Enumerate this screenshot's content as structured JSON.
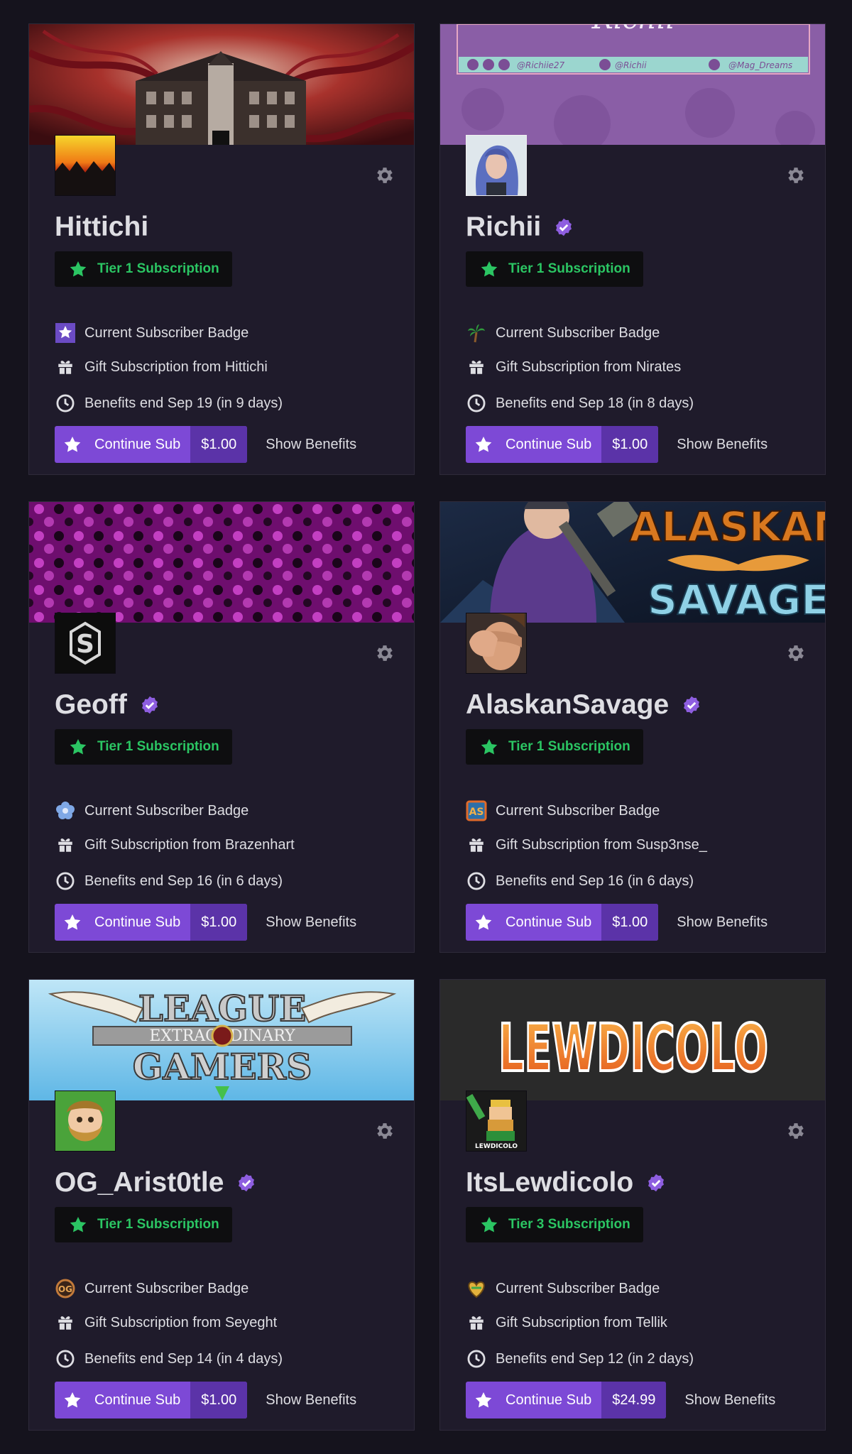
{
  "cards": [
    {
      "name": "Hittichi",
      "verified": false,
      "tier": "Tier 1 Subscription",
      "badge_label": "Current Subscriber Badge",
      "gift_label": "Gift Subscription from Hittichi",
      "benefits_end": "Benefits end Sep 19 (in 9 days)",
      "continue_label": "Continue Sub",
      "price": "$1.00",
      "show_benefits_label": "Show Benefits"
    },
    {
      "name": "Richii",
      "verified": true,
      "tier": "Tier 1 Subscription",
      "badge_label": "Current Subscriber Badge",
      "gift_label": "Gift Subscription from Nirates",
      "benefits_end": "Benefits end Sep 18 (in 8 days)",
      "continue_label": "Continue Sub",
      "price": "$1.00",
      "show_benefits_label": "Show Benefits",
      "banner_text": {
        "handle1": "@Richiie27",
        "handle2": "@Richii",
        "handle3": "@Mag_Dreams"
      }
    },
    {
      "name": "Geoff",
      "verified": true,
      "tier": "Tier 1 Subscription",
      "badge_label": "Current Subscriber Badge",
      "gift_label": "Gift Subscription from Brazenhart",
      "benefits_end": "Benefits end Sep 16 (in 6 days)",
      "continue_label": "Continue Sub",
      "price": "$1.00",
      "show_benefits_label": "Show Benefits"
    },
    {
      "name": "AlaskanSavage",
      "verified": true,
      "tier": "Tier 1 Subscription",
      "badge_label": "Current Subscriber Badge",
      "gift_label": "Gift Subscription from Susp3nse_",
      "benefits_end": "Benefits end Sep 16 (in 6 days)",
      "continue_label": "Continue Sub",
      "price": "$1.00",
      "show_benefits_label": "Show Benefits",
      "banner_text": {
        "line1": "ALASKAN",
        "line2": "SAVAGE"
      }
    },
    {
      "name": "OG_Arist0tle",
      "verified": true,
      "tier": "Tier 1 Subscription",
      "badge_label": "Current Subscriber Badge",
      "gift_label": "Gift Subscription from Seyeght",
      "benefits_end": "Benefits end Sep 14 (in 4 days)",
      "continue_label": "Continue Sub",
      "price": "$1.00",
      "show_benefits_label": "Show Benefits",
      "banner_text": {
        "line1": "LEAGUE",
        "line2": "EXTRAORDINARY",
        "line3": "GAMERS"
      }
    },
    {
      "name": "ItsLewdicolo",
      "verified": true,
      "tier": "Tier 3 Subscription",
      "badge_label": "Current Subscriber Badge",
      "gift_label": "Gift Subscription from Tellik",
      "benefits_end": "Benefits end Sep 12 (in 2 days)",
      "continue_label": "Continue Sub",
      "price": "$24.99",
      "show_benefits_label": "Show Benefits",
      "banner_text": {
        "line1": "LEWDICOLO"
      },
      "avatar_text": "LEWDICOLO"
    }
  ],
  "colors": {
    "page_bg": "#15131d",
    "card_bg": "#1f1b2b",
    "accent": "#7d49d6",
    "accent_dark": "#5b33a8",
    "tier_green": "#2bc563",
    "verified": "#8e5ee0",
    "gear": "#8a8894"
  },
  "icons": {
    "tier": "star-icon",
    "gift": "gift-icon",
    "clock": "clock-icon",
    "settings": "gear-icon",
    "continue": "star-icon",
    "verified": "verified-badge-icon"
  }
}
